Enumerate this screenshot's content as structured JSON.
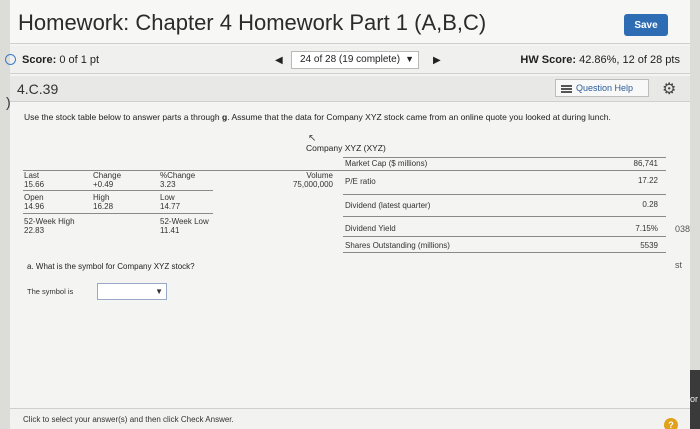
{
  "header": {
    "title": "Homework: Chapter 4 Homework Part 1 (A,B,C)",
    "save_label": "Save"
  },
  "score_bar": {
    "score_label": "Score:",
    "score_value": "0 of 1 pt",
    "progress": "24 of 28 (19 complete)",
    "hw_score_label": "HW Score:",
    "hw_score_value": "42.86%, 12 of 28 pts"
  },
  "question_bar": {
    "question_id": "4.C.39",
    "help_label": "Question Help"
  },
  "instructions": {
    "part1": "Use the stock table below to answer parts a through ",
    "part_bold": "g",
    "part2": ". Assume that the data for Company XYZ stock came from an online quote you looked at during lunch."
  },
  "stock_table": {
    "company": "Company XYZ (XYZ)",
    "left": {
      "last_label": "Last",
      "last_value": "15.66",
      "change_label": "Change",
      "change_value": "+0.49",
      "pct_change_label": "%Change",
      "pct_change_value": "3.23",
      "volume_label": "Volume",
      "volume_value": "75,000,000",
      "open_label": "Open",
      "open_value": "14.96",
      "high_label": "High",
      "high_value": "16.28",
      "low_label": "Low",
      "low_value": "14.77",
      "week52_high_label": "52-Week High",
      "week52_high_value": "22.83",
      "week52_low_label": "52-Week Low",
      "week52_low_value": "11.41"
    },
    "right": [
      {
        "label": "Market Cap ($ millions)",
        "value": "86,741"
      },
      {
        "label": "P/E ratio",
        "value": "17.22"
      },
      {
        "label": "Dividend (latest quarter)",
        "value": "0.28"
      },
      {
        "label": "Dividend Yield",
        "value": "7.15%"
      },
      {
        "label": "Shares Outstanding (millions)",
        "value": "5539"
      }
    ]
  },
  "question_a": "a. What is the symbol for Company XYZ stock?",
  "answer": {
    "label": "The symbol is",
    "value": ""
  },
  "footer": {
    "text": "Click to select your answer(s) and then click Check Answer.",
    "help": "?"
  },
  "background_fragments": {
    "f1": "038",
    "f2": "st",
    "f3": "or"
  },
  "colors": {
    "save_button": "#2e6db4",
    "help_icon": "#e0a21a",
    "link": "#2a5d9a"
  }
}
